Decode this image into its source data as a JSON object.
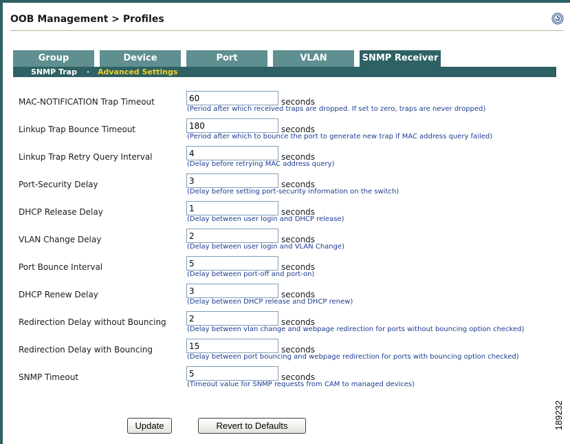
{
  "header": {
    "title": "OOB Management > Profiles",
    "help_icon": "help-refresh-icon"
  },
  "tabs": [
    {
      "label": "Group",
      "active": false
    },
    {
      "label": "Device",
      "active": false
    },
    {
      "label": "Port",
      "active": false
    },
    {
      "label": "VLAN",
      "active": false
    },
    {
      "label": "SNMP Receiver",
      "active": true
    }
  ],
  "subnav": {
    "items": [
      {
        "label": "SNMP Trap",
        "active": false
      },
      {
        "label": "Advanced Settings",
        "active": true
      }
    ],
    "separator": "·"
  },
  "fields": [
    {
      "label": "MAC-NOTIFICATION Trap Timeout",
      "value": "60",
      "unit": "seconds",
      "hint": "(Period after which received traps are dropped. If set to zero, traps are never dropped)"
    },
    {
      "label": "Linkup Trap Bounce Timeout",
      "value": "180",
      "unit": "seconds",
      "hint": "(Period after which to bounce the port to generate new trap if MAC address query failed)"
    },
    {
      "label": "Linkup Trap Retry Query Interval",
      "value": "4",
      "unit": "seconds",
      "hint": "(Delay before retrying MAC address query)"
    },
    {
      "label": "Port-Security Delay",
      "value": "3",
      "unit": "seconds",
      "hint": "(Delay before setting port-security information on the switch)"
    },
    {
      "label": "DHCP Release Delay",
      "value": "1",
      "unit": "seconds",
      "hint": "(Delay between user login and DHCP release)"
    },
    {
      "label": "VLAN Change Delay",
      "value": "2",
      "unit": "seconds",
      "hint": "(Delay between user login and VLAN Change)"
    },
    {
      "label": "Port Bounce Interval",
      "value": "5",
      "unit": "seconds",
      "hint": "(Delay between port-off and port-on)"
    },
    {
      "label": "DHCP Renew Delay",
      "value": "3",
      "unit": "seconds",
      "hint": "(Delay between DHCP release and DHCP renew)"
    },
    {
      "label": "Redirection Delay without Bouncing",
      "value": "2",
      "unit": "seconds",
      "hint": "(Delay between vlan change and webpage redirection for ports without bouncing option checked)"
    },
    {
      "label": "Redirection Delay with Bouncing",
      "value": "15",
      "unit": "seconds",
      "hint": "(Delay between port bouncing and webpage redirection for ports with bouncing option checked)"
    },
    {
      "label": "SNMP Timeout",
      "value": "5",
      "unit": "seconds",
      "hint": "(Timeout value for SNMP requests from CAM to managed devices)"
    }
  ],
  "buttons": {
    "update": "Update",
    "revert": "Revert to Defaults"
  },
  "figure_id": "189232",
  "colors": {
    "tab": "#5f8f90",
    "tab_active": "#2e6163",
    "subnav_active": "#f2d02a",
    "hint": "#1b3b8f"
  }
}
